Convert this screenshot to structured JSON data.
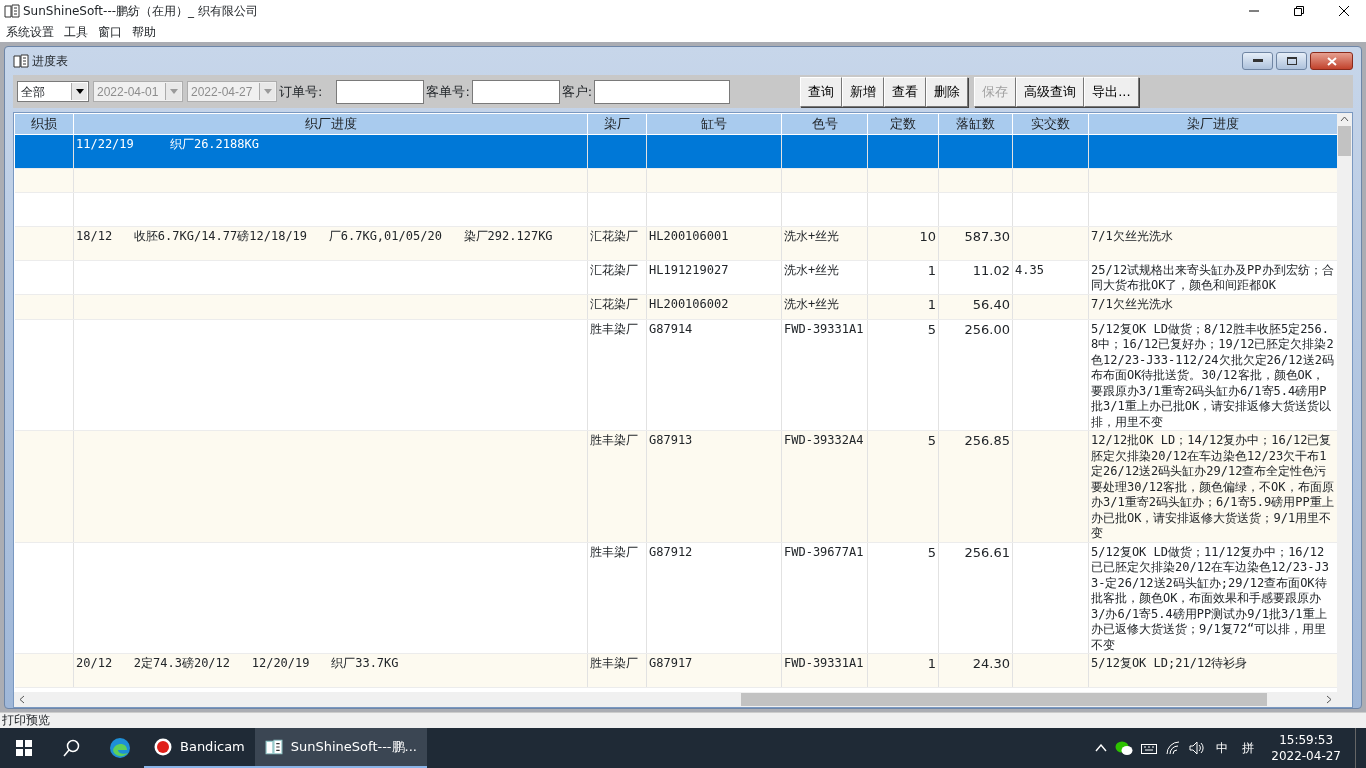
{
  "window": {
    "title": "SunShineSoft---鹏纺（在用）_      织有限公司"
  },
  "menu": [
    {
      "label": "系统设置"
    },
    {
      "label": "工具"
    },
    {
      "label": "窗口"
    },
    {
      "label": "帮助"
    }
  ],
  "child_window": {
    "title": "进度表"
  },
  "filter": {
    "scope": {
      "value": "全部",
      "disabled": false
    },
    "dates": [
      {
        "value": "2022-04-01",
        "disabled": true
      },
      {
        "value": "2022-04-27",
        "disabled": true
      }
    ],
    "fields": [
      {
        "label": "订单号:"
      },
      {
        "label": "客单号:"
      },
      {
        "label": "客户:"
      }
    ]
  },
  "buttons": [
    {
      "label": "查询",
      "disabled": false
    },
    {
      "label": "新增",
      "disabled": false
    },
    {
      "label": "查看",
      "disabled": false
    },
    {
      "label": "删除",
      "disabled": false
    },
    {
      "label": "保存",
      "disabled": true
    },
    {
      "label": "高级查询",
      "disabled": false
    },
    {
      "label": "导出...",
      "disabled": false
    }
  ],
  "table": {
    "columns": [
      {
        "label": "织损"
      },
      {
        "label": "织厂进度"
      },
      {
        "label": "染厂"
      },
      {
        "label": "缸号"
      },
      {
        "label": "色号"
      },
      {
        "label": "定数"
      },
      {
        "label": "落缸数"
      },
      {
        "label": "实交数"
      },
      {
        "label": "染厂进度"
      }
    ],
    "rows": [
      {
        "selected": true,
        "cells": [
          null,
          "11/22/19     织厂26.2188KG",
          null,
          null,
          null,
          null,
          null,
          null,
          null
        ]
      },
      {
        "selected": false,
        "cells": [
          null,
          null,
          null,
          null,
          null,
          null,
          null,
          null,
          null
        ]
      },
      {
        "selected": false,
        "cells": [
          null,
          null,
          null,
          null,
          null,
          null,
          null,
          null,
          null
        ]
      },
      {
        "selected": false,
        "cells": [
          null,
          "18/12   收胚6.7KG/14.77磅12/18/19   厂6.7KG,01/05/20   染厂292.127KG",
          "汇花染厂",
          "HL200106001",
          "洗水+丝光",
          "10",
          "587.30",
          null,
          "7/1欠丝光洗水"
        ]
      },
      {
        "selected": false,
        "cells": [
          null,
          null,
          "汇花染厂",
          "HL191219027",
          "洗水+丝光",
          "1",
          "11.02",
          "4.35",
          "25/12试规格出来寄头缸办及PP办到宏纺；合同大货布批OK了，颜色和间距都OK"
        ]
      },
      {
        "selected": false,
        "cells": [
          null,
          null,
          "汇花染厂",
          "HL200106002",
          "洗水+丝光",
          "1",
          "56.40",
          null,
          "7/1欠丝光洗水"
        ]
      },
      {
        "selected": false,
        "cells": [
          null,
          null,
          "胜丰染厂",
          "G87914",
          "FWD-39331A1",
          "5",
          "256.00",
          null,
          "5/12复OK LD做货；8/12胜丰收胚5定256.8中；16/12已复好办；19/12已胚定欠排染2色12/23-J33-112/24欠批欠定26/12送2码布布面OK待批送货。30/12客批，颜色OK，要跟原办3/1重寄2码头缸办6/1寄5.4磅用P批3/1重上办已批OK，请安排返修大货送货以排，用里不变"
        ]
      },
      {
        "selected": false,
        "cells": [
          null,
          null,
          "胜丰染厂",
          "G87913",
          "FWD-39332A4",
          "5",
          "256.85",
          null,
          "12/12批OK LD；14/12复办中；16/12已复胚定欠排染20/12在车边染色12/23欠干布1定26/12送2码头缸办29/12查布全定性色污要处理30/12客批，颜色偏绿，不OK，布面原办3/1重寄2码头缸办；6/1寄5.9磅用PP重上办已批OK，请安排返修大货送货；9/1用里不变"
        ]
      },
      {
        "selected": false,
        "cells": [
          null,
          null,
          "胜丰染厂",
          "G87912",
          "FWD-39677A1",
          "5",
          "256.61",
          null,
          "5/12复OK LD做货；11/12复办中；16/12已已胚定欠排染20/12在车边染色12/23-J33-定26/12送2码头缸办;29/12查布面OK待批客批，颜色OK，布面效果和手感要跟原办3/办6/1寄5.4磅用PP测试办9/1批3/1重上办已返修大货送货；9/1复72“可以排，用里不变"
        ]
      },
      {
        "selected": false,
        "cells": [
          null,
          "20/12   2定74.3磅20/12   12/20/19   织厂33.7KG",
          "胜丰染厂",
          "G87917",
          "FWD-39331A1",
          "1",
          "24.30",
          null,
          "5/12复OK LD;21/12待衫身"
        ]
      }
    ]
  },
  "status_bar": {
    "text": "打印预览"
  },
  "taskbar": {
    "apps": [
      {
        "label": "Bandicam",
        "active": false
      },
      {
        "label": "SunShineSoft---鹏...",
        "active": true
      }
    ],
    "tray": {
      "ime": "中",
      "ime_mode": "拼",
      "time": "15:59:53",
      "date": "2022-04-27"
    }
  }
}
